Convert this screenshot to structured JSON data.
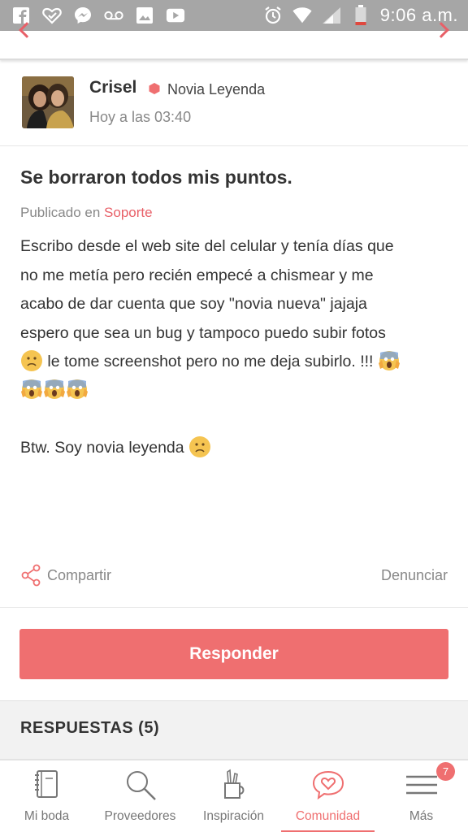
{
  "status_bar": {
    "time": "9:06 a.m.",
    "left_icons": [
      "facebook-icon",
      "heart-check-icon",
      "messenger-icon",
      "voicemail-icon",
      "image-icon",
      "youtube-icon"
    ],
    "right_icons": [
      "alarm-icon",
      "wifi-icon",
      "signal-icon",
      "battery-icon"
    ]
  },
  "author": {
    "name": "Crisel",
    "rank": "Novia Leyenda",
    "time": "Hoy a las 03:40"
  },
  "post": {
    "title": "Se borraron todos mis puntos.",
    "published_prefix": "Publicado en",
    "category": "Soporte",
    "body_lines": [
      "Escribo desde el web site del celular y tenía días que",
      "no me metía pero recién empecé a chismear y me",
      "acabo de dar cuenta que soy \"novia nueva\" jajaja",
      "espero que sea un bug y tampoco puedo subir fotos"
    ],
    "body_line5": "le tome screenshot pero no me deja subirlo. !!!",
    "body_btw": "Btw. Soy novia leyenda"
  },
  "actions": {
    "share": "Compartir",
    "report": "Denunciar"
  },
  "reply_button": "Responder",
  "responses_title": "RESPUESTAS (5)",
  "nav": {
    "items": [
      {
        "label": "Mi boda",
        "icon": "notebook-icon"
      },
      {
        "label": "Proveedores",
        "icon": "search-icon"
      },
      {
        "label": "Inspiración",
        "icon": "pencil-cup-icon"
      },
      {
        "label": "Comunidad",
        "icon": "heart-bubble-icon"
      },
      {
        "label": "Más",
        "icon": "menu-icon"
      }
    ],
    "active_index": 3,
    "badge": "7"
  },
  "colors": {
    "accent": "#ef6f70",
    "status_bar": "#a6a6a6"
  }
}
